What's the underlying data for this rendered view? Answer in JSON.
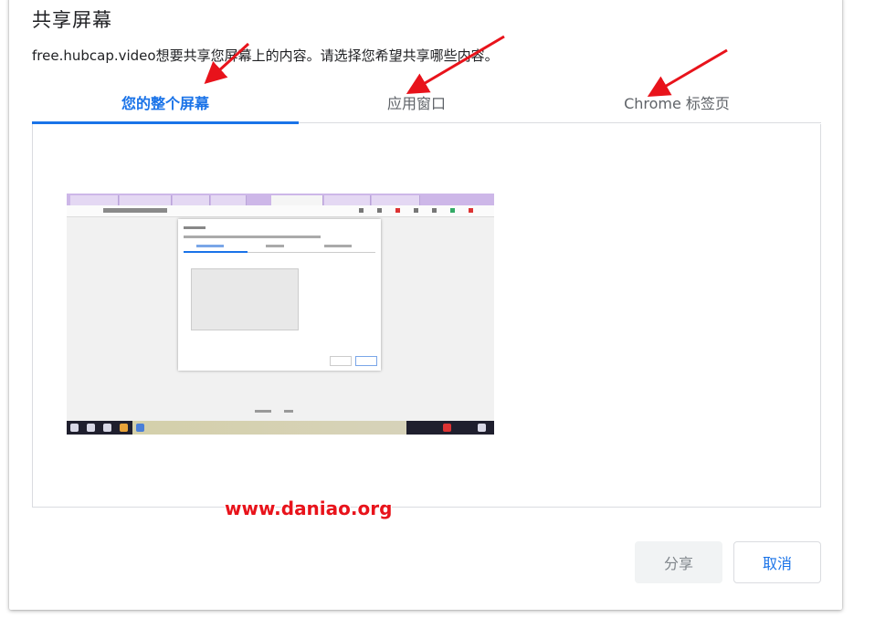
{
  "dialog": {
    "title": "共享屏幕",
    "description": "free.hubcap.video想要共享您屏幕上的内容。请选择您希望共享哪些内容。"
  },
  "tabs": [
    {
      "label": "您的整个屏幕",
      "selected": true
    },
    {
      "label": "应用窗口",
      "selected": false
    },
    {
      "label": "Chrome 标签页",
      "selected": false
    }
  ],
  "watermark": "www.daniao.org",
  "buttons": {
    "share_label": "分享",
    "cancel_label": "取消"
  },
  "colors": {
    "accent": "#1a73e8",
    "annotation_arrow": "#e8131b"
  }
}
